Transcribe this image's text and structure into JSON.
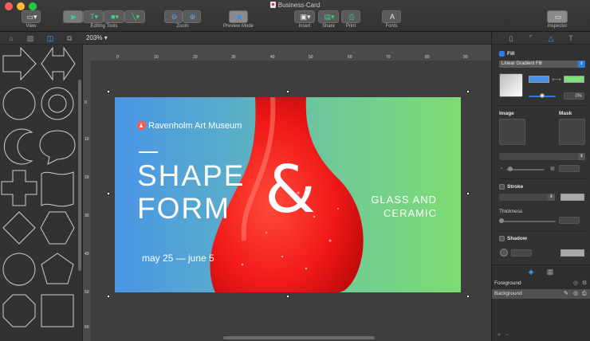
{
  "window": {
    "title": "Business-Card"
  },
  "toolbar": {
    "view_label": "View",
    "editing_tools_label": "Editing Tools",
    "zoom_label": "Zoom",
    "preview_mode_label": "Preview Mode",
    "insert_label": "Insert",
    "share_label": "Share",
    "print_label": "Print",
    "fonts_label": "Fonts",
    "inspector_label": "Inspector"
  },
  "canvas": {
    "zoom": "203%",
    "ruler_top": [
      "0",
      "10",
      "20",
      "30",
      "40",
      "50",
      "60",
      "70",
      "80",
      "90"
    ],
    "ruler_left": [
      "0",
      "10",
      "20",
      "30",
      "40",
      "50",
      "60"
    ]
  },
  "card": {
    "museum": "Ravenholm Art Museum",
    "line1": "SHAPE",
    "line2": "FORM",
    "amp": "&",
    "glass1": "GLASS AND",
    "glass2": "CERAMIC",
    "date": "may 25 — june 5",
    "colors": {
      "gradient_start": "#4a95e6",
      "gradient_end": "#7ddc72",
      "vase": "#f01818"
    }
  },
  "inspector": {
    "fill_label": "Fill",
    "fill_type": "Linear Gradient Fill",
    "angle": "0%",
    "image_label": "Image",
    "mask_label": "Mask",
    "stroke_label": "Stroke",
    "thickness_label": "Thickness",
    "shadow_label": "Shadow",
    "swatch_start": "#4a90e2",
    "swatch_end": "#7fe07f"
  },
  "layers": [
    {
      "name": "Foreground"
    },
    {
      "name": "Background"
    }
  ]
}
